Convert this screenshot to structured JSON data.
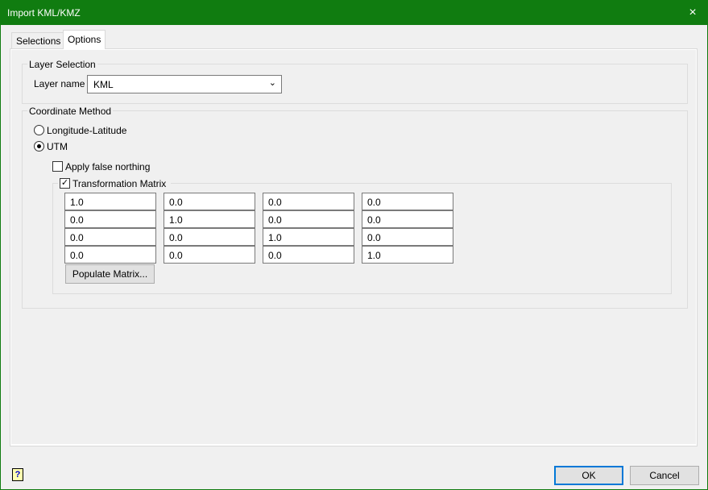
{
  "window": {
    "title": "Import KML/KMZ",
    "close_icon": "×"
  },
  "tabs": [
    {
      "label": "Selections"
    },
    {
      "label": "Options"
    }
  ],
  "layer_selection": {
    "legend": "Layer Selection",
    "layer_name_label": "Layer name",
    "layer_name_value": "KML"
  },
  "coordinate_method": {
    "legend": "Coordinate Method",
    "options": [
      "Longitude-Latitude",
      "UTM"
    ],
    "selected": "UTM",
    "apply_false_northing": {
      "label": "Apply false northing",
      "checked": false
    },
    "transformation_matrix": {
      "label": "Transformation Matrix",
      "checked": true,
      "rows": [
        [
          "1.0",
          "0.0",
          "0.0",
          "0.0"
        ],
        [
          "0.0",
          "1.0",
          "0.0",
          "0.0"
        ],
        [
          "0.0",
          "0.0",
          "1.0",
          "0.0"
        ],
        [
          "0.0",
          "0.0",
          "0.0",
          "1.0"
        ]
      ],
      "populate_label": "Populate Matrix..."
    }
  },
  "footer": {
    "help_icon": "?",
    "ok": "OK",
    "cancel": "Cancel"
  }
}
